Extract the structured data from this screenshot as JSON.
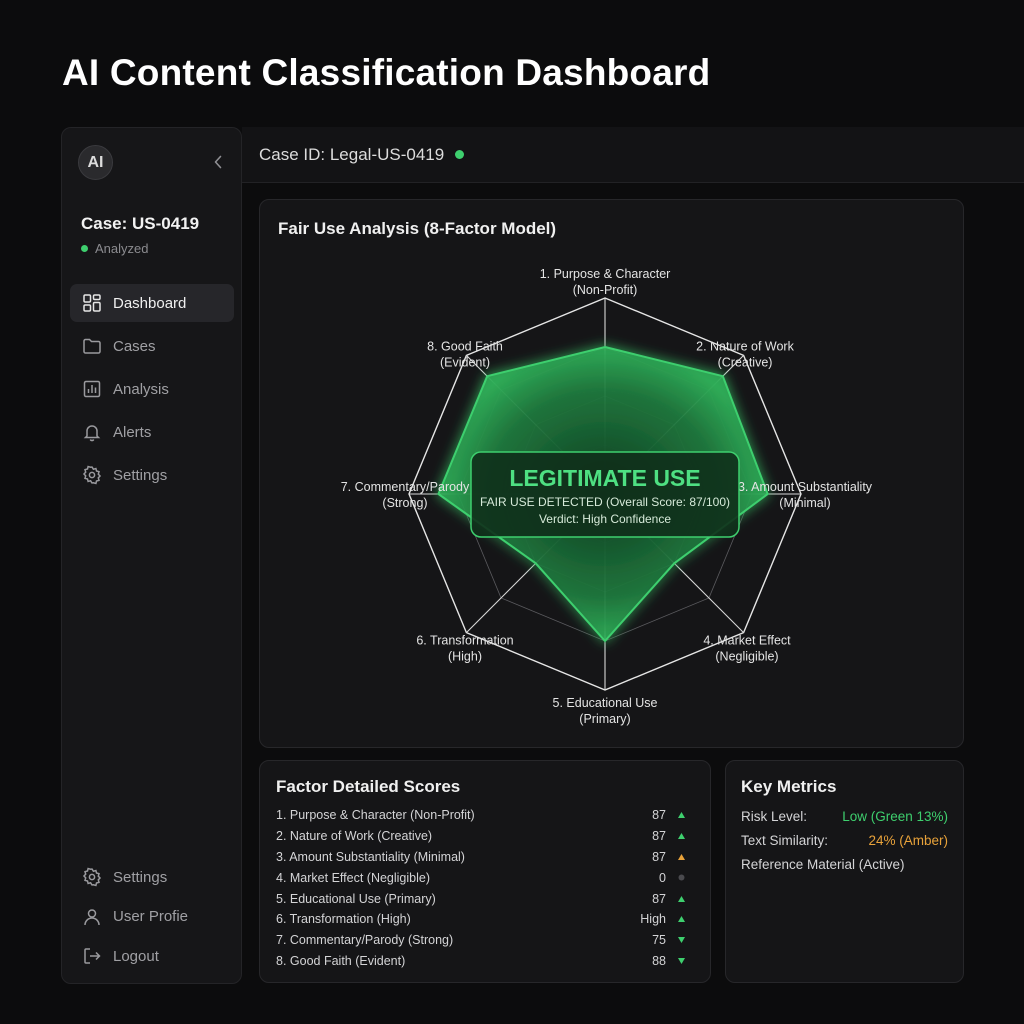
{
  "page": {
    "title": "AI Content Classification Dashboard"
  },
  "sidebar": {
    "logo": "AI",
    "case_title": "Case: US-0419",
    "case_status": "Analyzed",
    "items": [
      {
        "label": "Dashboard",
        "icon": "dashboard-icon",
        "active": true
      },
      {
        "label": "Cases",
        "icon": "folder-icon"
      },
      {
        "label": "Analysis",
        "icon": "bar-chart-icon"
      },
      {
        "label": "Alerts",
        "icon": "bell-icon"
      },
      {
        "label": "Settings",
        "icon": "gear-icon"
      }
    ],
    "bottom_items": [
      {
        "label": "Settings",
        "icon": "gear-icon"
      },
      {
        "label": "User Profie",
        "icon": "user-icon"
      },
      {
        "label": "Logout",
        "icon": "logout-icon"
      }
    ]
  },
  "header": {
    "case_id": "Case ID: Legal-US-0419",
    "status_color": "#3ecf6e"
  },
  "radar": {
    "title": "Fair Use Analysis (8-Factor Model)",
    "factors": [
      {
        "name": "1. Purpose & Character",
        "sub": "(Non-Profit)",
        "value": 0.75
      },
      {
        "name": "2. Nature of Work",
        "sub": "(Creative)",
        "value": 0.85
      },
      {
        "name": "3. Amount Substantiality",
        "sub": "(Minimal)",
        "value": 0.83
      },
      {
        "name": "4. Market Effect",
        "sub": "(Negligible)",
        "value": 0.5
      },
      {
        "name": "5. Educational Use",
        "sub": "(Primary)",
        "value": 0.75
      },
      {
        "name": "6. Transformation",
        "sub": "(High)",
        "value": 0.5
      },
      {
        "name": "7. Commentary/Parody",
        "sub": "(Strong)",
        "value": 0.85
      },
      {
        "name": "8. Good Faith",
        "sub": "(Evident)",
        "value": 0.85
      }
    ],
    "verdict_title": "LEGITIMATE USE",
    "verdict_detail": "FAIR USE DETECTED (Overall Score: 87/100)",
    "verdict_confidence": "Verdict: High Confidence",
    "accent": "#3ecf6e"
  },
  "scores": {
    "title": "Factor Detailed Scores",
    "rows": [
      {
        "name": "1. Purpose & Character (Non-Profit)",
        "value": "87",
        "indicator": "up",
        "color": "#3ecf6e"
      },
      {
        "name": "2. Nature of Work (Creative)",
        "value": "87",
        "indicator": "up",
        "color": "#3ecf6e"
      },
      {
        "name": "3. Amount Substantiality (Minimal)",
        "value": "87",
        "indicator": "up",
        "color": "#e8a23a"
      },
      {
        "name": "4. Market Effect (Negligible)",
        "value": "0",
        "indicator": "dot",
        "color": "#4a4a4e"
      },
      {
        "name": "5. Educational Use (Primary)",
        "value": "87",
        "indicator": "up",
        "color": "#3ecf6e"
      },
      {
        "name": "6. Transformation (High)",
        "value": "High",
        "indicator": "up",
        "color": "#3ecf6e"
      },
      {
        "name": "7. Commentary/Parody (Strong)",
        "value": "75",
        "indicator": "down",
        "color": "#3ecf6e"
      },
      {
        "name": "8. Good Faith (Evident)",
        "value": "88",
        "indicator": "down",
        "color": "#3ecf6e"
      }
    ]
  },
  "metrics": {
    "title": "Key Metrics",
    "rows": [
      {
        "label": "Risk Level:",
        "value": "Low (Green 13%)",
        "color": "#3ecf6e"
      },
      {
        "label": "Text Similarity:",
        "value": "24% (Amber)",
        "color": "#e8a23a"
      },
      {
        "label": "Reference Material (Active)",
        "value": "",
        "color": ""
      }
    ]
  }
}
